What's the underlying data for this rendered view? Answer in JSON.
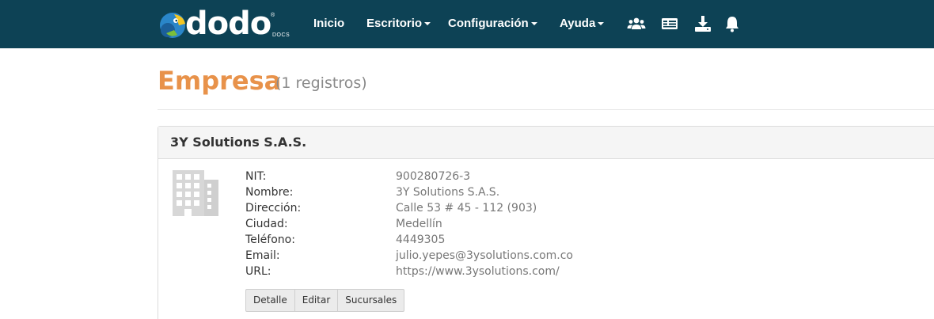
{
  "navbar": {
    "logo_text": "dodo",
    "logo_reg": "®",
    "logo_sub": "DOCS",
    "items": [
      {
        "label": "Inicio"
      },
      {
        "label": "Escritorio"
      },
      {
        "label": "Configuración"
      },
      {
        "label": "Ayuda"
      }
    ],
    "icons": [
      "users-icon",
      "id-card-icon",
      "download-icon",
      "bell-icon"
    ],
    "background": "#0d4255"
  },
  "page": {
    "title": "Empresa",
    "count": "(1 registros)",
    "title_color": "#e8924a"
  },
  "company": {
    "name": "3Y Solutions S.A.S.",
    "icon": "building-icon",
    "fields": [
      {
        "label": "NIT:",
        "value": "900280726-3"
      },
      {
        "label": "Nombre:",
        "value": "3Y Solutions S.A.S."
      },
      {
        "label": "Dirección:",
        "value": "Calle 53 # 45 - 112 (903)"
      },
      {
        "label": "Ciudad:",
        "value": "Medellín"
      },
      {
        "label": "Teléfono:",
        "value": "4449305"
      },
      {
        "label": "Email:",
        "value": "julio.yepes@3ysolutions.com.co"
      },
      {
        "label": "URL:",
        "value": "https://www.3ysolutions.com/"
      }
    ],
    "actions": [
      {
        "label": "Detalle"
      },
      {
        "label": "Editar"
      },
      {
        "label": "Sucursales"
      }
    ]
  }
}
